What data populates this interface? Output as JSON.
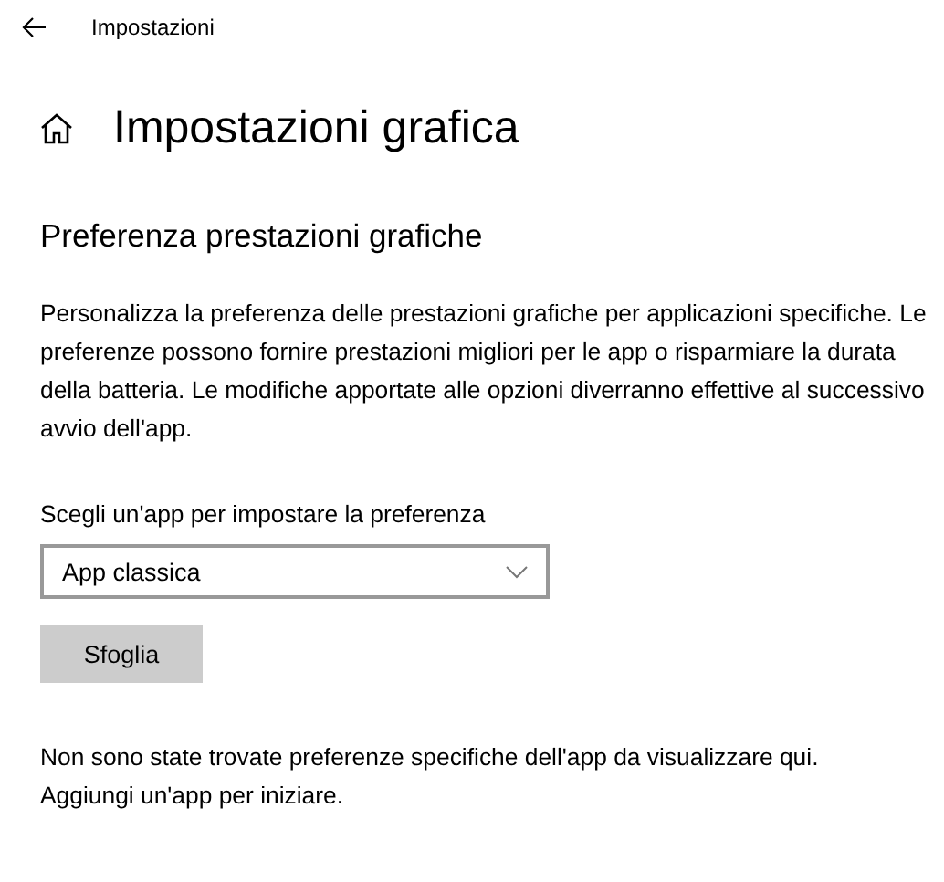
{
  "window": {
    "title": "Impostazioni"
  },
  "page": {
    "title": "Impostazioni grafica"
  },
  "section": {
    "title": "Preferenza prestazioni grafiche",
    "description": "Personalizza la preferenza delle prestazioni grafiche per applicazioni specifiche. Le preferenze possono fornire prestazioni migliori per le app o risparmiare la durata della batteria. Le modifiche apportate alle opzioni diverranno effettive al successivo avvio dell'app."
  },
  "app_picker": {
    "label": "Scegli un'app per impostare la preferenza",
    "value": "App classica"
  },
  "buttons": [
    "Sfoglia"
  ],
  "empty_message": "Non sono state trovate preferenze specifiche dell'app da visualizzare qui. Aggiungi un'app per iniziare."
}
